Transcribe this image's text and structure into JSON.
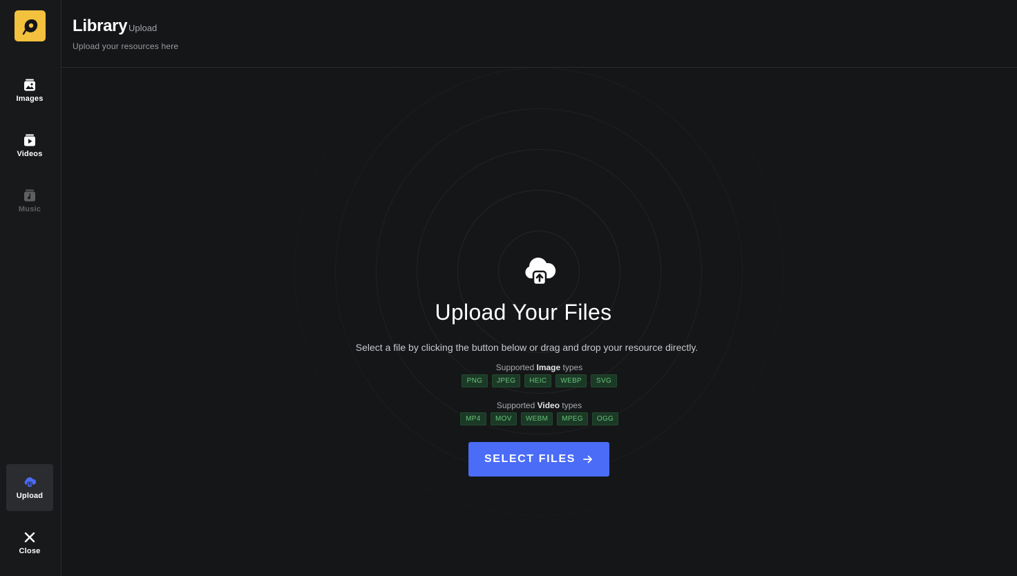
{
  "app": {
    "title": "Library",
    "breadcrumb": "Upload",
    "subtitle": "Upload your resources here"
  },
  "sidebar": {
    "logo": "map-pin-logo",
    "items": [
      {
        "label": "Images",
        "icon": "image-icon",
        "state": "enabled"
      },
      {
        "label": "Videos",
        "icon": "video-icon",
        "state": "enabled"
      },
      {
        "label": "Music",
        "icon": "music-icon",
        "state": "disabled"
      },
      {
        "label": "Upload",
        "icon": "cloud-upload-icon",
        "state": "active"
      },
      {
        "label": "Close",
        "icon": "close-icon",
        "state": "enabled"
      }
    ]
  },
  "main": {
    "heading": "Upload Your Files",
    "description": "Select a file by clicking the button below or drag and drop your resource directly.",
    "image_support": {
      "prefix": "Supported ",
      "kind": "Image",
      "suffix": " types",
      "types": [
        "PNG",
        "JPEG",
        "HEIC",
        "WEBP",
        "SVG"
      ]
    },
    "video_support": {
      "prefix": "Supported ",
      "kind": "Video",
      "suffix": " types",
      "types": [
        "MP4",
        "MOV",
        "WEBM",
        "MPEG",
        "OGG"
      ]
    },
    "select_button": "SELECT FILES"
  },
  "colors": {
    "accent": "#4a6cf7",
    "logo": "#f3c13e",
    "chip_text": "#69c27a",
    "chip_bg": "#1b3a26"
  }
}
